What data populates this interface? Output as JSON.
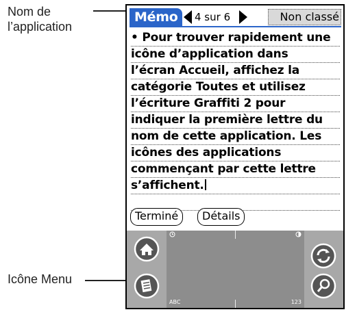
{
  "callouts": {
    "app_name": [
      "Nom de",
      "l’application"
    ],
    "menu_icon": "Icône Menu"
  },
  "titlebar": {
    "app_name": "Mémo",
    "counter": "4 sur 6",
    "category": "Non classé"
  },
  "memo": {
    "lines": [
      "• Pour trouver rapidement une",
      "icône d’application dans",
      "l’écran Accueil, affichez la",
      "catégorie Toutes et utilisez",
      "l’écriture Graffiti 2 pour",
      "indiquer la première lettre du",
      "nom de cette application. Les",
      "icônes des applications",
      "commençant par cette lettre",
      "s’affichent.",
      ""
    ]
  },
  "buttons": {
    "done": "Terminé",
    "details": "Détails"
  },
  "graffiti": {
    "abc_label": "ABC",
    "num_label": "123"
  },
  "colors": {
    "accent": "#2b65c9",
    "graffiti_bg": "#a8a8a8",
    "write_area": "#8d8d8d"
  },
  "icons": [
    "home-icon",
    "menu-icon",
    "sync-icon",
    "find-icon",
    "clock-icon",
    "contrast-icon"
  ]
}
